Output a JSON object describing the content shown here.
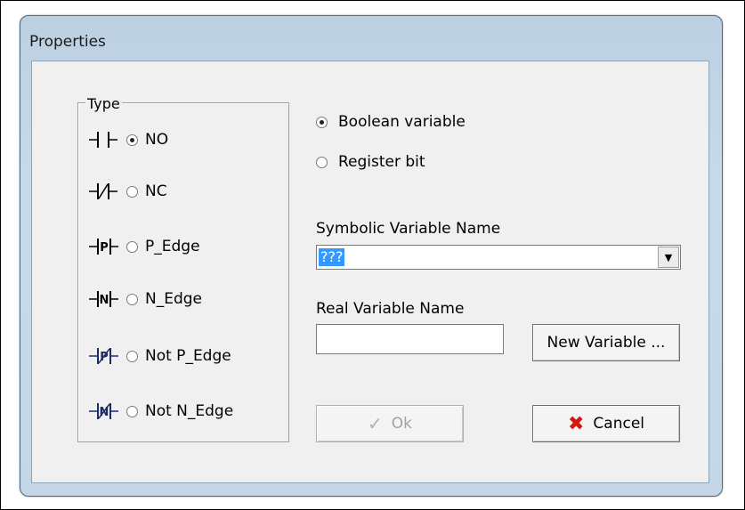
{
  "window": {
    "title": "Properties"
  },
  "type_group": {
    "legend": "Type",
    "options": [
      {
        "label": "NO",
        "checked": true,
        "icon": "contact-no-icon"
      },
      {
        "label": "NC",
        "checked": false,
        "icon": "contact-nc-icon"
      },
      {
        "label": "P_Edge",
        "checked": false,
        "icon": "contact-p-edge-icon"
      },
      {
        "label": "N_Edge",
        "checked": false,
        "icon": "contact-n-edge-icon"
      },
      {
        "label": "Not P_Edge",
        "checked": false,
        "icon": "contact-not-p-edge-icon"
      },
      {
        "label": "Not N_Edge",
        "checked": false,
        "icon": "contact-not-n-edge-icon"
      }
    ]
  },
  "source": {
    "options": [
      {
        "label": "Boolean variable",
        "checked": true
      },
      {
        "label": "Register bit",
        "checked": false
      }
    ]
  },
  "symbolic": {
    "label": "Symbolic Variable Name",
    "value": "???"
  },
  "real": {
    "label": "Real Variable Name",
    "value": ""
  },
  "buttons": {
    "new_variable": "New Variable ...",
    "ok": "Ok",
    "cancel": "Cancel"
  },
  "colors": {
    "selection": "#3399ff",
    "cancel_icon": "#d11a0e",
    "ladder_blue": "#1a2d6b"
  }
}
